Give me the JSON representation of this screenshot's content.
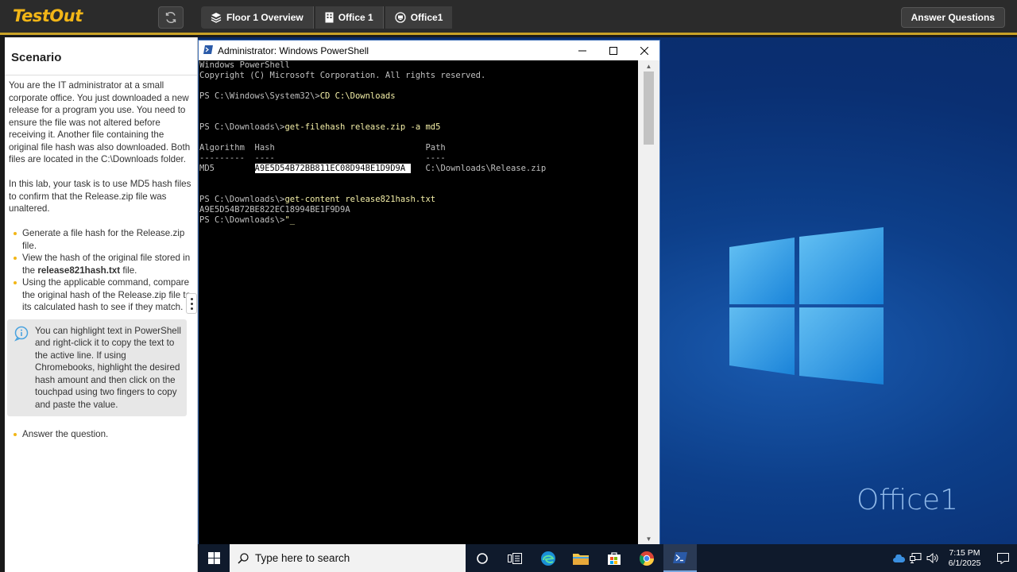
{
  "app": {
    "logo": "TestOut"
  },
  "breadcrumbs": [
    "Floor 1 Overview",
    "Office 1",
    "Office1"
  ],
  "answer_button": "Answer Questions",
  "scenario": {
    "title": "Scenario",
    "intro": "You are the IT administrator at a small corporate office. You just downloaded a new release for a program you use. You need to ensure the file was not altered before receiving it. Another file containing the original file hash was also downloaded. Both files are located in the C:\\Downloads folder.",
    "task": "In this lab, your task is to use MD5 hash files to confirm that the Release.zip file was unaltered.",
    "steps": [
      {
        "pre": "Generate a file hash for the Release.zip file.",
        "bold": "",
        "post": ""
      },
      {
        "pre": "View the hash of the original file stored in the ",
        "bold": "release821hash.txt",
        "post": " file."
      },
      {
        "pre": "Using the applicable command, compare the original hash of the Release.zip file to its calculated hash to see if they match.",
        "bold": "",
        "post": ""
      }
    ],
    "note": "You can highlight text in PowerShell and right-click it to copy the text to the active line. If using Chromebooks, highlight the desired hash amount and then click on the touchpad using two fingers to copy and paste the value.",
    "final_step": "Answer the question."
  },
  "powershell": {
    "title": "Administrator: Windows PowerShell",
    "lines": [
      {
        "text": "Windows PowerShell"
      },
      {
        "text": "Copyright (C) Microsoft Corporation. All rights reserved."
      },
      {
        "text": ""
      },
      {
        "prompt": "PS C:\\Windows\\System32\\>",
        "cmd": "CD C:\\Downloads"
      },
      {
        "text": ""
      },
      {
        "text": ""
      },
      {
        "prompt": "PS C:\\Downloads\\>",
        "cmd": "get-filehash release.zip -a md5"
      },
      {
        "text": ""
      },
      {
        "text": "Algorithm  Hash                              Path"
      },
      {
        "text": "---------  ----                              ----"
      },
      {
        "pre": "MD5        ",
        "hl": "A9E5D54B72BB811EC08D94BE1D9D9A ",
        "post": "   C:\\Downloads\\Release.zip"
      },
      {
        "text": ""
      },
      {
        "text": ""
      },
      {
        "prompt": "PS C:\\Downloads\\>",
        "cmd": "get-content release821hash.txt"
      },
      {
        "text": "A9E5D54B72BE822EC18994BE1F9D9A"
      },
      {
        "prompt": "PS C:\\Downloads\\>",
        "cmd": "\"_"
      }
    ]
  },
  "desktop": {
    "label": "Office1"
  },
  "taskbar": {
    "search_placeholder": "Type here to search",
    "time": "7:15 PM",
    "date": "6/1/2025"
  }
}
